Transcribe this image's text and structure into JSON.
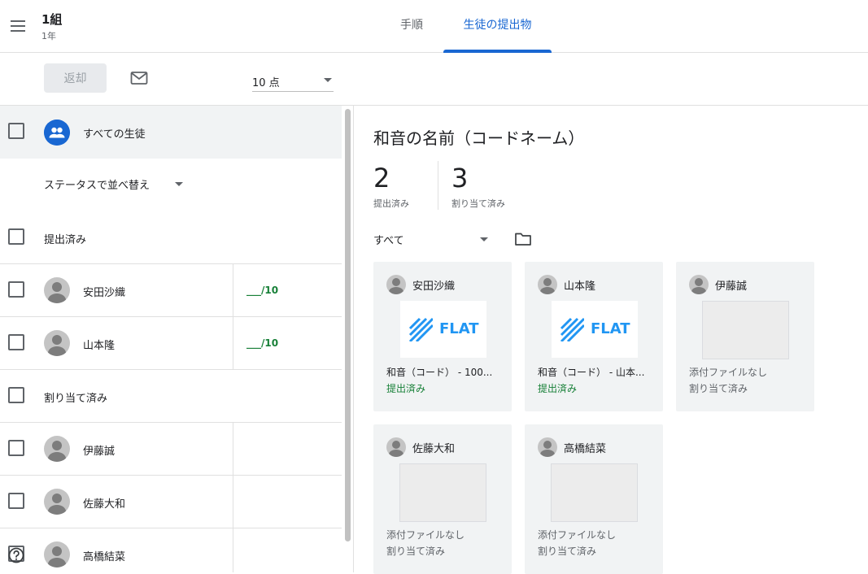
{
  "header": {
    "class_name": "1組",
    "class_section": "1年",
    "tabs": [
      {
        "label": "手順",
        "active": false
      },
      {
        "label": "生徒の提出物",
        "active": true
      }
    ],
    "accent_color": "#1967d2"
  },
  "toolbar": {
    "return_label": "返却",
    "points_value": "10 点"
  },
  "student_list": {
    "all_students_label": "すべての生徒",
    "sort_label": "ステータスで並べ替え",
    "groups": [
      {
        "label": "提出済み",
        "students": [
          {
            "name": "安田沙織",
            "grade": "___/10"
          },
          {
            "name": "山本隆",
            "grade": "___/10"
          }
        ]
      },
      {
        "label": "割り当て済み",
        "students": [
          {
            "name": "伊藤誠",
            "grade": ""
          },
          {
            "name": "佐藤大和",
            "grade": ""
          },
          {
            "name": "高橋結菜",
            "grade": ""
          }
        ]
      }
    ]
  },
  "assignment": {
    "title": "和音の名前（コードネーム）",
    "submitted_count": "2",
    "submitted_label": "提出済み",
    "assigned_count": "3",
    "assigned_label": "割り当て済み",
    "filter_value": "すべて",
    "cards": [
      {
        "name": "安田沙織",
        "thumbnail": "FLAT",
        "file": "和音（コード） - 100...",
        "status": "提出済み"
      },
      {
        "name": "山本隆",
        "thumbnail": "FLAT",
        "file": "和音（コード） - 山本...",
        "status": "提出済み"
      },
      {
        "name": "伊藤誠",
        "thumbnail": "",
        "file": "添付ファイルなし",
        "status": "割り当て済み"
      },
      {
        "name": "佐藤大和",
        "thumbnail": "",
        "file": "添付ファイルなし",
        "status": "割り当て済み"
      },
      {
        "name": "高橋結菜",
        "thumbnail": "",
        "file": "添付ファイルなし",
        "status": "割り当て済み"
      }
    ]
  }
}
